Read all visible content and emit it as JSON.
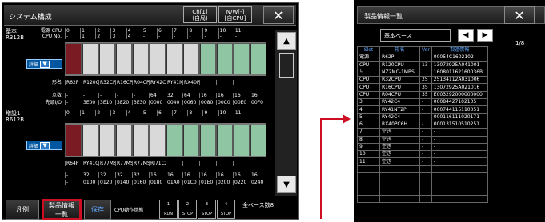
{
  "system_window": {
    "title": "システム構成",
    "ch_label": "Ch[1]\n(自局)",
    "nw_label": "N/W[-]\n[自CPU]",
    "close_label": "✕"
  },
  "base_section": {
    "name": "基本",
    "model": "R312B",
    "detail_label": "詳細",
    "cpu_no_label": "CPU No.",
    "power_label": "電源",
    "cpu_label": "CPU",
    "slot_numbers": [
      "0",
      "1",
      "2",
      "3",
      "4",
      "5",
      "6",
      "7",
      "8",
      "9",
      "10",
      "11"
    ],
    "cpu_numbers": [
      "-",
      "1",
      "2",
      "3",
      "4",
      "-",
      "-",
      "-",
      "-",
      "-",
      "-",
      "-"
    ],
    "model_label": "形名",
    "models": [
      "R62P",
      "R120CPU",
      "R32CPU",
      "R16CPU",
      "R04CPU",
      "RY42C4",
      "RY41NT2P",
      "RX40PC6H",
      "",
      "",
      "",
      ""
    ],
    "points_label": "点数",
    "points": [
      "-",
      "-",
      "-",
      "-",
      "-",
      "64",
      "32",
      "64",
      "16",
      "16",
      "16",
      "16"
    ],
    "io_label": "先頭I/O",
    "ios": [
      "-",
      "3E00",
      "3E10",
      "3E20",
      "3E30",
      "0000",
      "0040",
      "0060",
      "0080",
      "00C0",
      "00E0",
      "00F0"
    ]
  },
  "ext_section": {
    "name": "増設1",
    "model": "R612B",
    "detail_label": "詳細",
    "slot_numbers": [
      "0",
      "1",
      "2",
      "3",
      "4",
      "5",
      "6",
      "7",
      "8",
      "9",
      "10",
      "11"
    ],
    "models": [
      "R64P",
      "RY41C4",
      "R77MS4",
      "R77MS4",
      "R77MS4",
      "RJ71C24",
      "",
      "",
      "",
      "",
      "",
      ""
    ],
    "points": [
      "-",
      "32",
      "32",
      "32",
      "32",
      "16",
      "16",
      "16",
      "16",
      "16",
      "16",
      "16"
    ],
    "ios": [
      "-",
      "0100",
      "0120",
      "0140",
      "0160",
      "0180",
      "01A0",
      "01C0",
      "01E0",
      "0200",
      "0220",
      "0240"
    ]
  },
  "bottom_bar": {
    "legend": "凡例",
    "product_info": "製品情報\n一覧",
    "save": "保存",
    "cpu_status": "CPU動作状態",
    "indicators": [
      "1",
      "2",
      "3",
      "4"
    ],
    "run_labels": [
      "RUN",
      "STOP",
      "STOP",
      "STOP"
    ],
    "all_base": "全ベース数8"
  },
  "product_window": {
    "title": "製品情報一覧",
    "base_select": "基本ベース",
    "page": "1/8",
    "close_label": "✕",
    "prev": "◀",
    "next": "▶",
    "columns": [
      "Slot",
      "形名",
      "Ver",
      "製造情報"
    ],
    "rows": [
      [
        "電源",
        "R62P",
        "-",
        "00054C1602102"
      ],
      [
        "CPU",
        "R120CPU",
        "13",
        "13072925A041001"
      ],
      [
        "└",
        "NZ2MC-1MBS",
        "",
        "160801162160036B"
      ],
      [
        "CPU",
        "R32CPU",
        "25",
        "25134112A031006"
      ],
      [
        "CPU",
        "R16CPU",
        "35",
        "13072925A021016"
      ],
      [
        "CPU",
        "R04CPU",
        "35",
        "E003292000000000"
      ],
      [
        "3",
        "RY42C4",
        "-",
        "00084427102105"
      ],
      [
        "4",
        "RY41NT2P",
        "-",
        "000744115110051"
      ],
      [
        "5",
        "RY42C4",
        "-",
        "000116111020171"
      ],
      [
        "6",
        "RX40PC6H",
        "-",
        "000131510510251"
      ],
      [
        "7",
        "空き",
        "-",
        "-"
      ],
      [
        "8",
        "空き",
        "-",
        "-"
      ],
      [
        "9",
        "空き",
        "-",
        "-"
      ],
      [
        "10",
        "空き",
        "-",
        "-"
      ],
      [
        "11",
        "空き",
        "-",
        "-"
      ],
      [
        "",
        "",
        "",
        ""
      ],
      [
        "",
        "",
        "",
        ""
      ],
      [
        "",
        "",
        "",
        ""
      ],
      [
        "",
        "",
        "",
        ""
      ],
      [
        "",
        "",
        "",
        ""
      ]
    ]
  },
  "colors": {
    "accent": "#00569f",
    "highlight": "#cc0f22",
    "module_green": "#8fc5a3"
  }
}
